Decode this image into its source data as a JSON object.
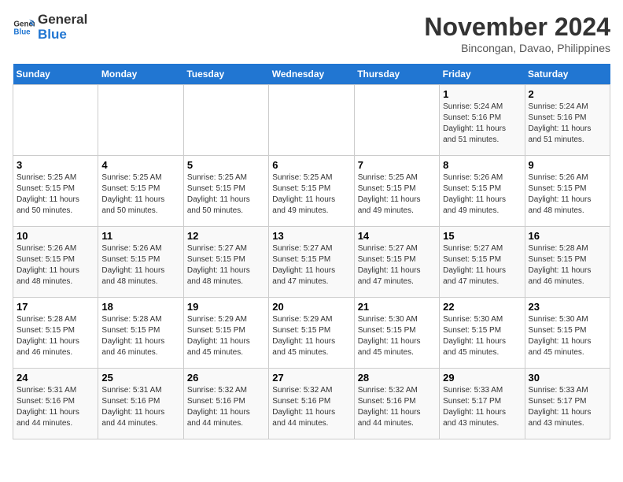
{
  "header": {
    "logo_line1": "General",
    "logo_line2": "Blue",
    "month": "November 2024",
    "location": "Bincongan, Davao, Philippines"
  },
  "weekdays": [
    "Sunday",
    "Monday",
    "Tuesday",
    "Wednesday",
    "Thursday",
    "Friday",
    "Saturday"
  ],
  "weeks": [
    [
      {
        "day": "",
        "info": ""
      },
      {
        "day": "",
        "info": ""
      },
      {
        "day": "",
        "info": ""
      },
      {
        "day": "",
        "info": ""
      },
      {
        "day": "",
        "info": ""
      },
      {
        "day": "1",
        "info": "Sunrise: 5:24 AM\nSunset: 5:16 PM\nDaylight: 11 hours\nand 51 minutes."
      },
      {
        "day": "2",
        "info": "Sunrise: 5:24 AM\nSunset: 5:16 PM\nDaylight: 11 hours\nand 51 minutes."
      }
    ],
    [
      {
        "day": "3",
        "info": "Sunrise: 5:25 AM\nSunset: 5:15 PM\nDaylight: 11 hours\nand 50 minutes."
      },
      {
        "day": "4",
        "info": "Sunrise: 5:25 AM\nSunset: 5:15 PM\nDaylight: 11 hours\nand 50 minutes."
      },
      {
        "day": "5",
        "info": "Sunrise: 5:25 AM\nSunset: 5:15 PM\nDaylight: 11 hours\nand 50 minutes."
      },
      {
        "day": "6",
        "info": "Sunrise: 5:25 AM\nSunset: 5:15 PM\nDaylight: 11 hours\nand 49 minutes."
      },
      {
        "day": "7",
        "info": "Sunrise: 5:25 AM\nSunset: 5:15 PM\nDaylight: 11 hours\nand 49 minutes."
      },
      {
        "day": "8",
        "info": "Sunrise: 5:26 AM\nSunset: 5:15 PM\nDaylight: 11 hours\nand 49 minutes."
      },
      {
        "day": "9",
        "info": "Sunrise: 5:26 AM\nSunset: 5:15 PM\nDaylight: 11 hours\nand 48 minutes."
      }
    ],
    [
      {
        "day": "10",
        "info": "Sunrise: 5:26 AM\nSunset: 5:15 PM\nDaylight: 11 hours\nand 48 minutes."
      },
      {
        "day": "11",
        "info": "Sunrise: 5:26 AM\nSunset: 5:15 PM\nDaylight: 11 hours\nand 48 minutes."
      },
      {
        "day": "12",
        "info": "Sunrise: 5:27 AM\nSunset: 5:15 PM\nDaylight: 11 hours\nand 48 minutes."
      },
      {
        "day": "13",
        "info": "Sunrise: 5:27 AM\nSunset: 5:15 PM\nDaylight: 11 hours\nand 47 minutes."
      },
      {
        "day": "14",
        "info": "Sunrise: 5:27 AM\nSunset: 5:15 PM\nDaylight: 11 hours\nand 47 minutes."
      },
      {
        "day": "15",
        "info": "Sunrise: 5:27 AM\nSunset: 5:15 PM\nDaylight: 11 hours\nand 47 minutes."
      },
      {
        "day": "16",
        "info": "Sunrise: 5:28 AM\nSunset: 5:15 PM\nDaylight: 11 hours\nand 46 minutes."
      }
    ],
    [
      {
        "day": "17",
        "info": "Sunrise: 5:28 AM\nSunset: 5:15 PM\nDaylight: 11 hours\nand 46 minutes."
      },
      {
        "day": "18",
        "info": "Sunrise: 5:28 AM\nSunset: 5:15 PM\nDaylight: 11 hours\nand 46 minutes."
      },
      {
        "day": "19",
        "info": "Sunrise: 5:29 AM\nSunset: 5:15 PM\nDaylight: 11 hours\nand 45 minutes."
      },
      {
        "day": "20",
        "info": "Sunrise: 5:29 AM\nSunset: 5:15 PM\nDaylight: 11 hours\nand 45 minutes."
      },
      {
        "day": "21",
        "info": "Sunrise: 5:30 AM\nSunset: 5:15 PM\nDaylight: 11 hours\nand 45 minutes."
      },
      {
        "day": "22",
        "info": "Sunrise: 5:30 AM\nSunset: 5:15 PM\nDaylight: 11 hours\nand 45 minutes."
      },
      {
        "day": "23",
        "info": "Sunrise: 5:30 AM\nSunset: 5:15 PM\nDaylight: 11 hours\nand 45 minutes."
      }
    ],
    [
      {
        "day": "24",
        "info": "Sunrise: 5:31 AM\nSunset: 5:16 PM\nDaylight: 11 hours\nand 44 minutes."
      },
      {
        "day": "25",
        "info": "Sunrise: 5:31 AM\nSunset: 5:16 PM\nDaylight: 11 hours\nand 44 minutes."
      },
      {
        "day": "26",
        "info": "Sunrise: 5:32 AM\nSunset: 5:16 PM\nDaylight: 11 hours\nand 44 minutes."
      },
      {
        "day": "27",
        "info": "Sunrise: 5:32 AM\nSunset: 5:16 PM\nDaylight: 11 hours\nand 44 minutes."
      },
      {
        "day": "28",
        "info": "Sunrise: 5:32 AM\nSunset: 5:16 PM\nDaylight: 11 hours\nand 44 minutes."
      },
      {
        "day": "29",
        "info": "Sunrise: 5:33 AM\nSunset: 5:17 PM\nDaylight: 11 hours\nand 43 minutes."
      },
      {
        "day": "30",
        "info": "Sunrise: 5:33 AM\nSunset: 5:17 PM\nDaylight: 11 hours\nand 43 minutes."
      }
    ]
  ]
}
